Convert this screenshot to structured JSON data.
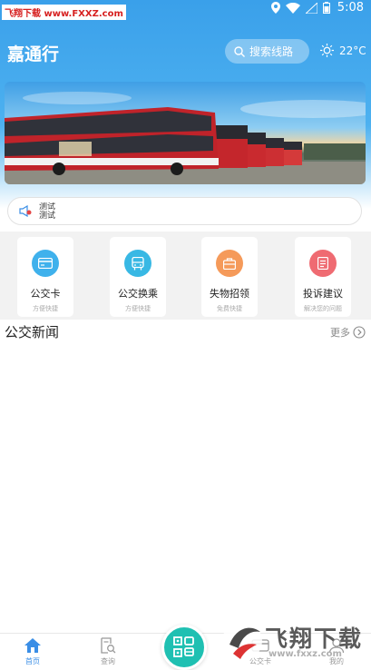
{
  "status_bar": {
    "watermark": "飞翔下载 www.FXXZ.com",
    "time": "5:08"
  },
  "header": {
    "title": "嘉通行",
    "search_label": "搜索线路",
    "temperature": "22°C"
  },
  "notice": {
    "lines": [
      "测试",
      "测试"
    ]
  },
  "menu": [
    {
      "label": "公交卡",
      "sub": "方便快捷",
      "icon": "bus-card-icon",
      "color": "#3fb1ec"
    },
    {
      "label": "公交换乘",
      "sub": "方便快捷",
      "icon": "bus-transfer-icon",
      "color": "#38b8e4"
    },
    {
      "label": "失物招领",
      "sub": "免费快捷",
      "icon": "lost-found-icon",
      "color": "#f59a5a"
    },
    {
      "label": "投诉建议",
      "sub": "解决您的问题",
      "icon": "complaint-icon",
      "color": "#ef6b72"
    }
  ],
  "news": {
    "title": "公交新闻",
    "more": "更多"
  },
  "tabbar": {
    "home": "首页",
    "query": "查询",
    "card": "公交卡",
    "mine": "我的"
  },
  "footer_watermark": {
    "brand": "飞翔下载",
    "url": "www.fxxz.com"
  },
  "colors": {
    "primary": "#3aa0ea",
    "accent": "#1fc0b2"
  }
}
